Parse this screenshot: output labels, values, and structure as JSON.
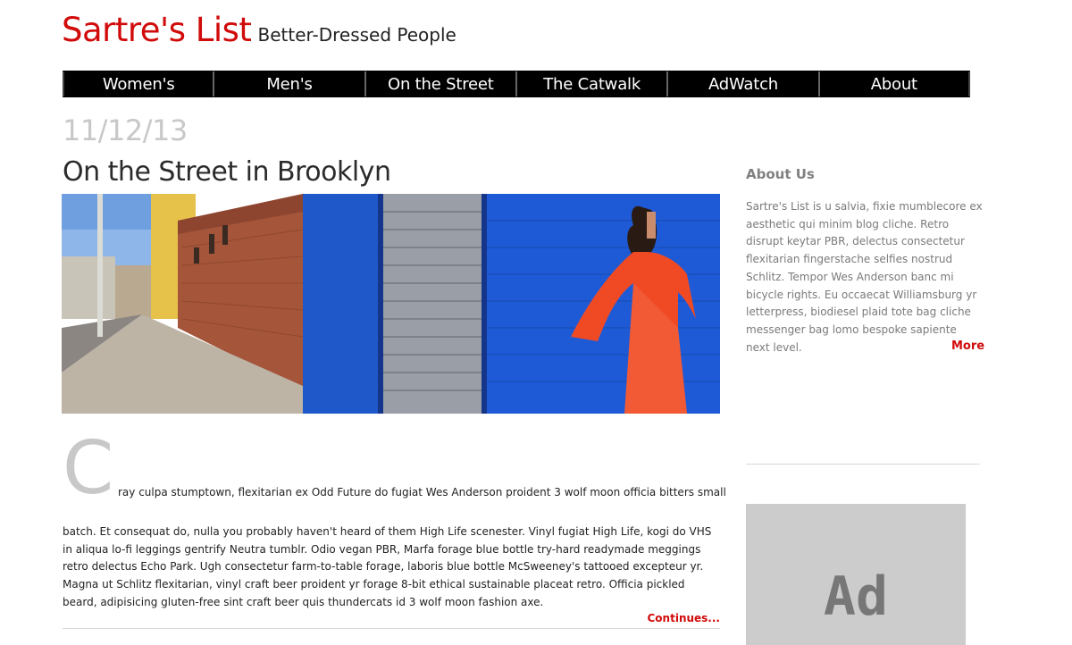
{
  "header": {
    "brand": "Sartre's List",
    "tagline": "Better-Dressed People"
  },
  "nav": {
    "items": [
      "Women's",
      "Men's",
      "On the Street",
      "The Catwalk",
      "AdWatch",
      "About"
    ]
  },
  "post": {
    "date": "11/12/13",
    "title": "On the Street in Brooklyn",
    "dropcap": "C",
    "first_line": "ray culpa stumptown, flexitarian ex Odd Future do fugiat Wes Anderson proident 3 wolf moon officia bitters small",
    "body": "batch. Et consequat do, nulla you probably haven't heard of them High Life scenester. Vinyl fugiat High Life, kogi do VHS in aliqua lo-fi leggings gentrify Neutra tumblr. Odio vegan PBR, Marfa forage blue bottle try-hard readymade meggings retro delectus Echo Park. Ugh consectetur farm-to-table forage, laboris blue bottle McSweeney's tattooed excepteur yr. Magna ut Schlitz flexitarian, vinyl craft beer proident yr forage 8-bit ethical sustainable placeat retro. Officia pickled beard, adipisicing gluten-free sint craft beer quis thundercats id 3 wolf moon fashion axe.",
    "continues_label": "Continues..."
  },
  "sidebar": {
    "title": "About Us",
    "text": "Sartre's List is u salvia, fixie mumblecore ex aesthetic qui minim blog cliche. Retro disrupt keytar PBR, delectus consectetur flexitarian fingerstache selfies nostrud Schlitz. Tempor Wes Anderson banc mi bicycle rights. Eu occaecat Williamsburg yr letterpress, biodiesel plaid tote bag cliche messenger bag lomo bespoke sapiente next level.",
    "more_label": "More"
  },
  "ad": {
    "label": "Ad"
  },
  "colors": {
    "accent": "#d10a0a",
    "nav_bg": "#000000",
    "muted": "#c8c8c8",
    "ad_bg": "#cccccc"
  }
}
